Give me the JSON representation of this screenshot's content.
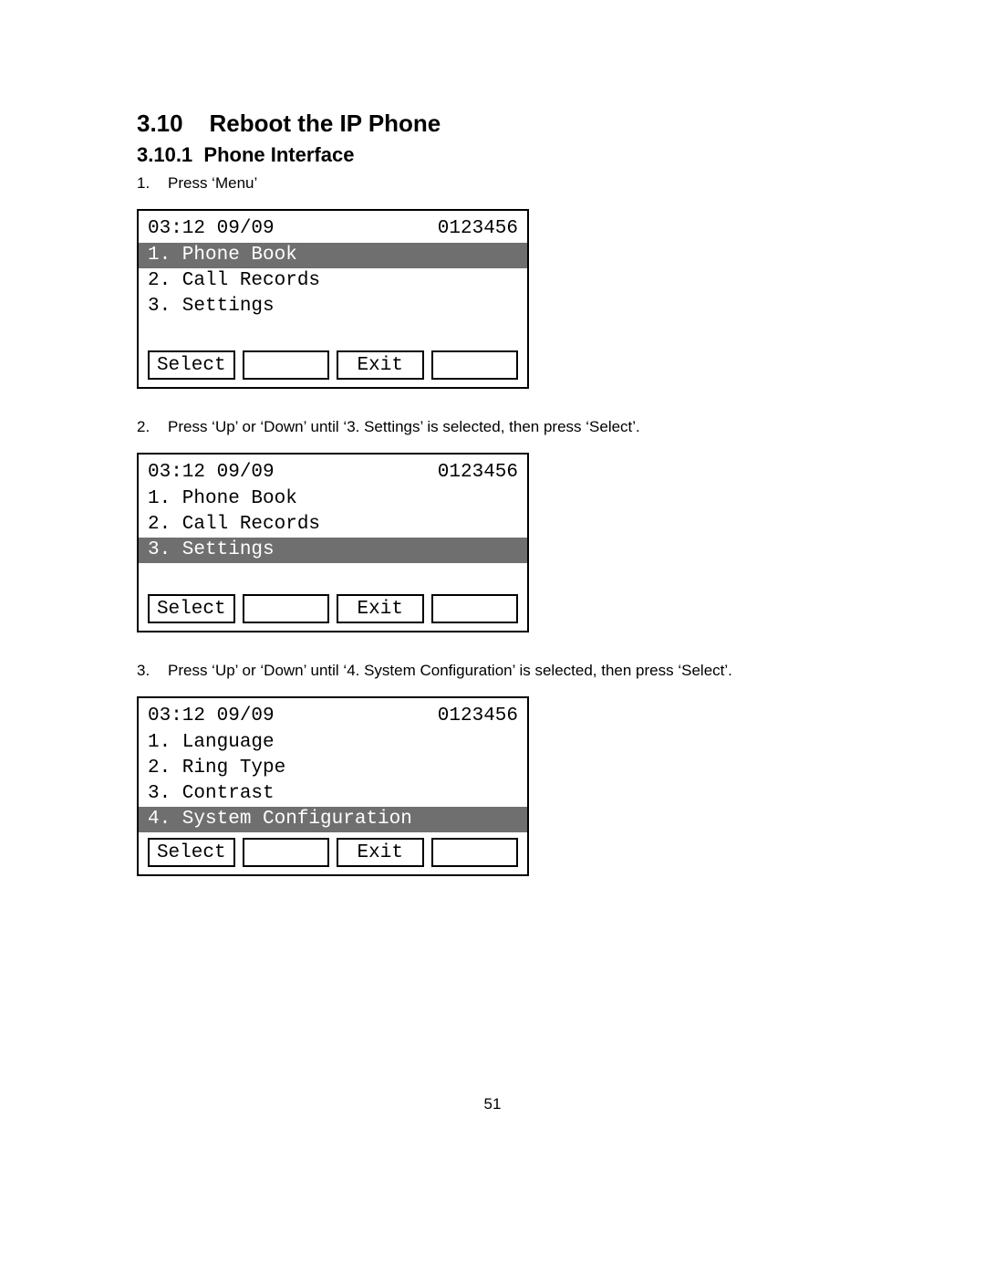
{
  "heading_number": "3.10",
  "heading_title": "Reboot the IP Phone",
  "subheading_number": "3.10.1",
  "subheading_title": "Phone Interface",
  "steps": {
    "s1": {
      "num": "1.",
      "text": "Press ‘Menu’"
    },
    "s2": {
      "num": "2.",
      "text": "Press ‘Up’ or ‘Down’ until ‘3. Settings’ is selected, then press ‘Select’."
    },
    "s3": {
      "num": "3.",
      "text": "Press ‘Up’ or ‘Down’ until ‘4. System Configuration’ is selected, then press ‘Select’."
    }
  },
  "screens": {
    "a": {
      "clock": "03:12 09/09",
      "number": "0123456",
      "items": {
        "i1": "1. Phone Book",
        "i2": "2. Call Records",
        "i3": "3. Settings"
      },
      "soft": {
        "left": "Select",
        "right": "Exit"
      }
    },
    "b": {
      "clock": "03:12 09/09",
      "number": "0123456",
      "items": {
        "i1": "1. Phone Book",
        "i2": "2. Call Records",
        "i3": "3. Settings"
      },
      "soft": {
        "left": "Select",
        "right": "Exit"
      }
    },
    "c": {
      "clock": "03:12 09/09",
      "number": "0123456",
      "items": {
        "i1": "1. Language",
        "i2": "2. Ring Type",
        "i3": "3. Contrast",
        "i4": "4. System Configuration"
      },
      "soft": {
        "left": "Select",
        "right": "Exit"
      }
    }
  },
  "page_number": "51",
  "sep": "    "
}
